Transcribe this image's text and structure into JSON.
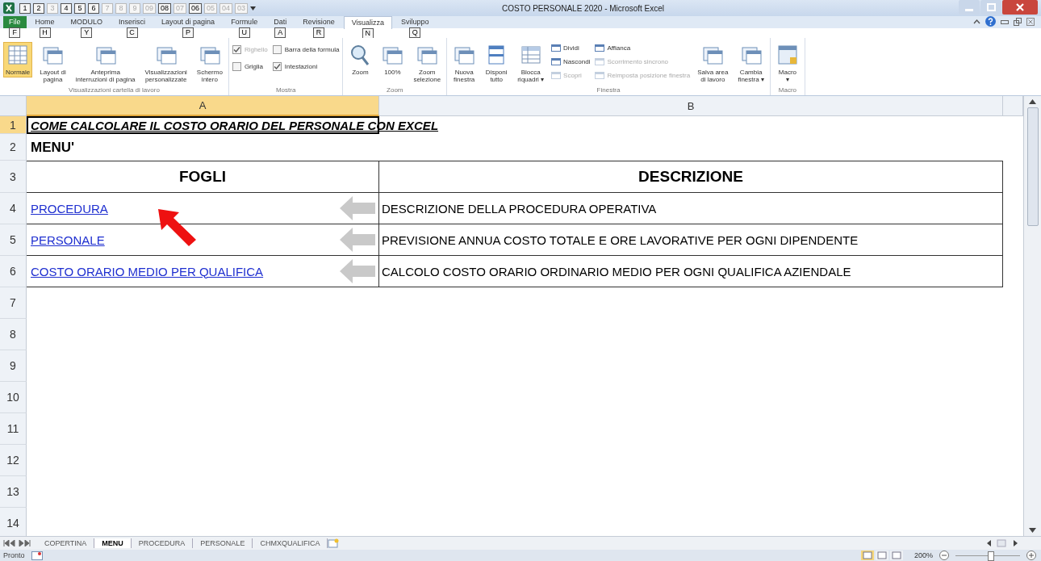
{
  "window": {
    "title": "COSTO PERSONALE 2020 - Microsoft Excel"
  },
  "quick_access_keytips": [
    {
      "label": "1",
      "disabled": false
    },
    {
      "label": "2",
      "disabled": false
    },
    {
      "label": "3",
      "disabled": true
    },
    {
      "label": "4",
      "disabled": false
    },
    {
      "label": "5",
      "disabled": false
    },
    {
      "label": "6",
      "disabled": false
    },
    {
      "label": "7",
      "disabled": true
    },
    {
      "label": "8",
      "disabled": true
    },
    {
      "label": "9",
      "disabled": true
    },
    {
      "label": "09",
      "disabled": true
    },
    {
      "label": "08",
      "disabled": false
    },
    {
      "label": "07",
      "disabled": true
    },
    {
      "label": "06",
      "disabled": false
    },
    {
      "label": "05",
      "disabled": true
    },
    {
      "label": "04",
      "disabled": true
    },
    {
      "label": "03",
      "disabled": true
    }
  ],
  "ribbon_tabs": [
    {
      "label": "File",
      "keytip": "F",
      "kind": "file",
      "selected": false
    },
    {
      "label": "Home",
      "keytip": "H",
      "kind": "tab",
      "selected": false
    },
    {
      "label": "MODULO",
      "keytip": "Y",
      "kind": "tab",
      "selected": false
    },
    {
      "label": "Inserisci",
      "keytip": "C",
      "kind": "tab",
      "selected": false
    },
    {
      "label": "Layout di pagina",
      "keytip": "P",
      "kind": "tab",
      "selected": false
    },
    {
      "label": "Formule",
      "keytip": "U",
      "kind": "tab",
      "selected": false
    },
    {
      "label": "Dati",
      "keytip": "A",
      "kind": "tab",
      "selected": false
    },
    {
      "label": "Revisione",
      "keytip": "R",
      "kind": "tab",
      "selected": false
    },
    {
      "label": "Visualizza",
      "keytip": "N",
      "kind": "tab",
      "selected": true
    },
    {
      "label": "Sviluppo",
      "keytip": "Q",
      "kind": "tab",
      "selected": false
    }
  ],
  "ribbon_groups": [
    {
      "title": "Visualizzazioni cartella di lavoro",
      "items": [
        {
          "kind": "large",
          "lines": [
            "Normale"
          ],
          "selected": true
        },
        {
          "kind": "large",
          "lines": [
            "Layout di",
            "pagina"
          ],
          "selected": false
        },
        {
          "kind": "large",
          "lines": [
            "Anteprima",
            "interruzioni di pagina"
          ],
          "selected": false
        },
        {
          "kind": "large",
          "lines": [
            "Visualizzazioni",
            "personalizzate"
          ],
          "selected": false
        },
        {
          "kind": "large",
          "lines": [
            "Schermo",
            "intero"
          ],
          "selected": false
        }
      ]
    },
    {
      "title": "Mostra",
      "items": [
        {
          "kind": "stack",
          "items": [
            {
              "kind": "check",
              "label": "Righello",
              "checked": true,
              "disabled": true
            },
            {
              "kind": "check",
              "label": "Griglia",
              "checked": false,
              "disabled": false
            }
          ]
        },
        {
          "kind": "stack",
          "items": [
            {
              "kind": "check",
              "label": "Barra della formula",
              "checked": false,
              "disabled": false
            },
            {
              "kind": "check",
              "label": "Intestazioni",
              "checked": true,
              "disabled": false
            }
          ]
        }
      ]
    },
    {
      "title": "Zoom",
      "items": [
        {
          "kind": "large",
          "lines": [
            "Zoom"
          ],
          "selected": false
        },
        {
          "kind": "large",
          "lines": [
            "100%"
          ],
          "selected": false
        },
        {
          "kind": "large",
          "lines": [
            "Zoom",
            "selezione"
          ],
          "selected": false
        }
      ]
    },
    {
      "title": "Finestra",
      "items": [
        {
          "kind": "large",
          "lines": [
            "Nuova",
            "finestra"
          ],
          "selected": false
        },
        {
          "kind": "large",
          "lines": [
            "Disponi",
            "tutto"
          ],
          "selected": false
        },
        {
          "kind": "large",
          "lines": [
            "Blocca",
            "riquadri ▾"
          ],
          "selected": false
        },
        {
          "kind": "stack",
          "items": [
            {
              "kind": "small",
              "label": "Dividi",
              "disabled": false
            },
            {
              "kind": "small",
              "label": "Nascondi",
              "disabled": false
            },
            {
              "kind": "small",
              "label": "Scopri",
              "disabled": true
            }
          ]
        },
        {
          "kind": "stack",
          "items": [
            {
              "kind": "small",
              "label": "Affianca",
              "disabled": false
            },
            {
              "kind": "small",
              "label": "Scorrimento sincrono",
              "disabled": true
            },
            {
              "kind": "small",
              "label": "Reimposta posizione finestra",
              "disabled": true
            }
          ]
        },
        {
          "kind": "large",
          "lines": [
            "Salva area",
            "di lavoro"
          ],
          "selected": false
        },
        {
          "kind": "large",
          "lines": [
            "Cambia",
            "finestra ▾"
          ],
          "selected": false
        }
      ]
    },
    {
      "title": "Macro",
      "items": [
        {
          "kind": "large",
          "lines": [
            "Macro",
            "▾"
          ],
          "selected": false
        }
      ]
    }
  ],
  "columns": [
    {
      "label": "A",
      "selected": true
    },
    {
      "label": "B",
      "selected": false
    }
  ],
  "rows": [
    {
      "number": "1",
      "selected": true,
      "kind": "title",
      "a": "COME CALCOLARE IL COSTO ORARIO DEL PERSONALE CON EXCEL"
    },
    {
      "number": "2",
      "selected": false,
      "kind": "heading",
      "a": "MENU'"
    },
    {
      "number": "3",
      "selected": false,
      "kind": "header",
      "a": "FOGLI",
      "b": "DESCRIZIONE"
    },
    {
      "number": "4",
      "selected": false,
      "kind": "link",
      "a": "PROCEDURA",
      "b": "DESCRIZIONE DELLA PROCEDURA OPERATIVA"
    },
    {
      "number": "5",
      "selected": false,
      "kind": "link",
      "a": "PERSONALE",
      "b": "PREVISIONE ANNUA COSTO TOTALE E ORE LAVORATIVE PER OGNI DIPENDENTE"
    },
    {
      "number": "6",
      "selected": false,
      "kind": "link",
      "a": "COSTO ORARIO MEDIO PER QUALIFICA",
      "b": "CALCOLO COSTO ORARIO ORDINARIO MEDIO PER OGNI QUALIFICA AZIENDALE"
    },
    {
      "number": "7",
      "selected": false,
      "kind": "empty"
    },
    {
      "number": "8",
      "selected": false,
      "kind": "empty"
    },
    {
      "number": "9",
      "selected": false,
      "kind": "empty"
    },
    {
      "number": "10",
      "selected": false,
      "kind": "empty"
    },
    {
      "number": "11",
      "selected": false,
      "kind": "empty"
    },
    {
      "number": "12",
      "selected": false,
      "kind": "empty"
    },
    {
      "number": "13",
      "selected": false,
      "kind": "empty"
    },
    {
      "number": "14",
      "selected": false,
      "kind": "empty"
    }
  ],
  "sheet_tabs": [
    {
      "label": "COPERTINA",
      "selected": false
    },
    {
      "label": "MENU",
      "selected": true
    },
    {
      "label": "PROCEDURA",
      "selected": false
    },
    {
      "label": "PERSONALE",
      "selected": false
    },
    {
      "label": "CHMXQUALIFICA",
      "selected": false
    }
  ],
  "status_bar": {
    "status": "Pronto",
    "views": [
      {
        "selected": true
      },
      {
        "selected": false
      },
      {
        "selected": false
      }
    ],
    "zoom": "200%",
    "zoom_slider": {
      "level": 0.55
    }
  }
}
